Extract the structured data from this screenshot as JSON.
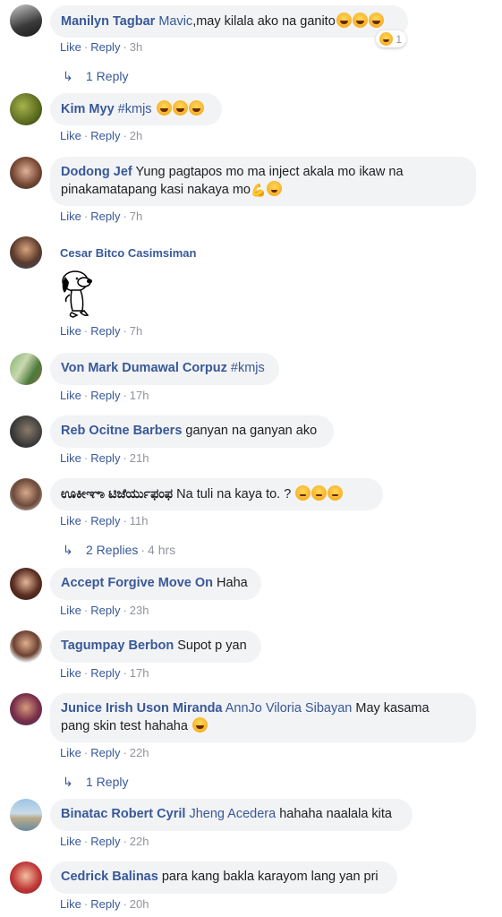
{
  "comments": [
    {
      "author": "Manilyn Tagbar",
      "mention": "Mavic",
      "text": ",may kilala ako na ganito",
      "emoji_count": 3,
      "reaction_count": "1",
      "like": "Like",
      "reply": "Reply",
      "time": "3h",
      "replies": "1 Reply"
    },
    {
      "author": "Kim Myy",
      "mention": "#kmjs",
      "text": "",
      "emoji_count": 3,
      "like": "Like",
      "reply": "Reply",
      "time": "2h"
    },
    {
      "author": "Dodong Jef",
      "text_line1": "Yung pagtapos mo ma inject akala mo ikaw na",
      "text_line2": "pinakamatapang kasi nakaya mo",
      "like": "Like",
      "reply": "Reply",
      "time": "7h"
    },
    {
      "author": "Cesar Bitco Casimsiman",
      "like": "Like",
      "reply": "Reply",
      "time": "7h"
    },
    {
      "author": "Von Mark Dumawal Corpuz",
      "mention": "#kmjs",
      "like": "Like",
      "reply": "Reply",
      "time": "17h"
    },
    {
      "author": "Reb Ocitne Barbers",
      "text": "ganyan na ganyan ako",
      "like": "Like",
      "reply": "Reply",
      "time": "21h"
    },
    {
      "author": "ಊಕೀಞಾ ಟಿಜೆರ್ಯುಫಂಫ",
      "text": "Na tuli na kaya to. ?",
      "like": "Like",
      "reply": "Reply",
      "time": "11h",
      "replies": "2 Replies",
      "replies_time": "4 hrs"
    },
    {
      "author": "Accept Forgive Move On",
      "text": "Haha",
      "like": "Like",
      "reply": "Reply",
      "time": "23h"
    },
    {
      "author": "Tagumpay Berbon",
      "text": "Supot p yan",
      "like": "Like",
      "reply": "Reply",
      "time": "17h"
    },
    {
      "author": "Junice Irish Uson Miranda",
      "mention": "AnnJo Viloria Sibayan",
      "text_line1": "May kasama",
      "text_line2": "pang skin test hahaha",
      "like": "Like",
      "reply": "Reply",
      "time": "22h",
      "replies": "1 Reply"
    },
    {
      "author": "Binatac Robert Cyril",
      "mention": "Jheng Acedera",
      "text": "hahaha naalala kita",
      "like": "Like",
      "reply": "Reply",
      "time": "22h"
    },
    {
      "author": "Cedrick Balinas",
      "text": "para kang bakla karayom lang yan pri",
      "like": "Like",
      "reply": "Reply",
      "time": "20h"
    }
  ],
  "colors": {
    "link": "#385898",
    "bubble": "#f2f3f5",
    "muted": "#90949c"
  }
}
